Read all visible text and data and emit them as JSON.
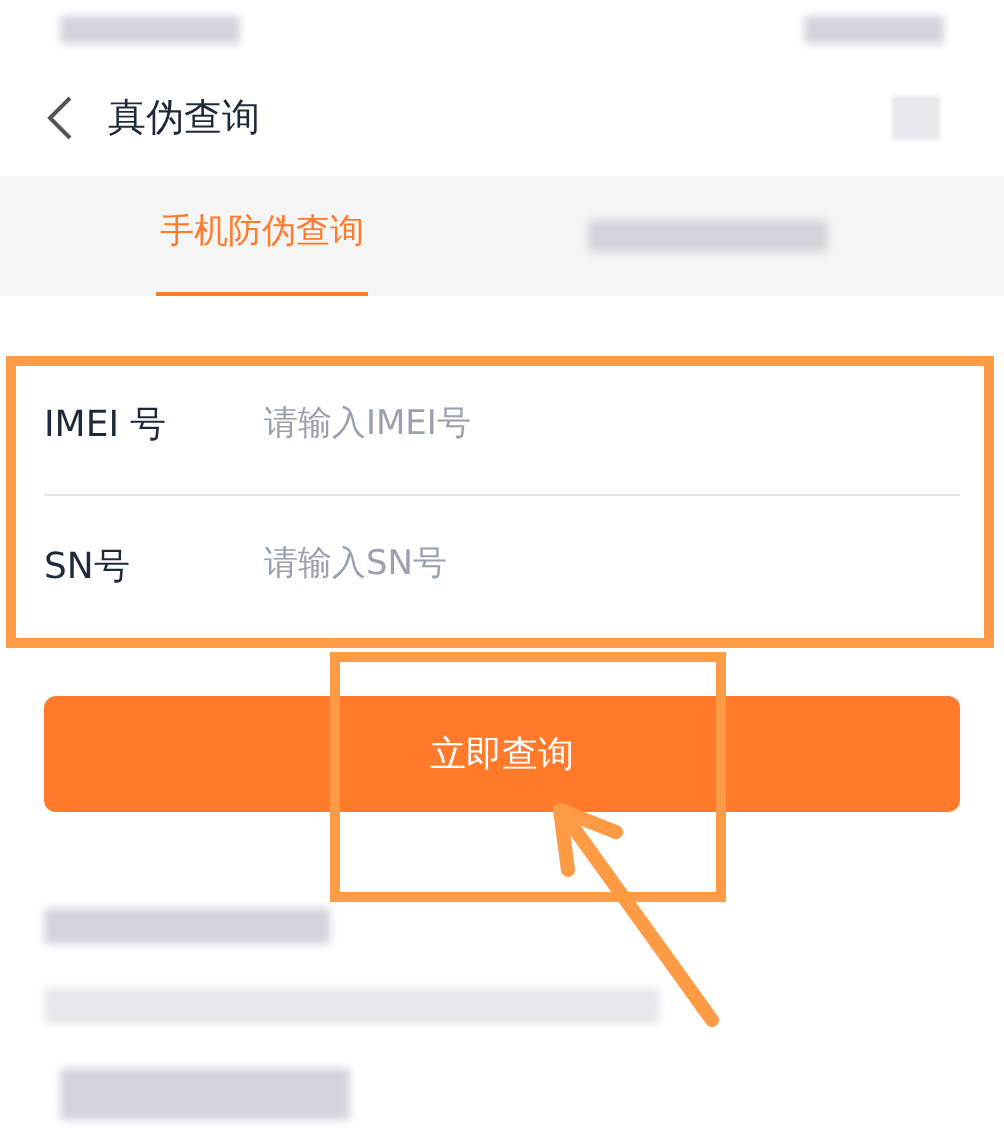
{
  "header": {
    "title": "真伪查询"
  },
  "tabs": [
    {
      "label": "手机防伪查询",
      "selected": true
    }
  ],
  "fields": [
    {
      "label": "IMEI 号",
      "placeholder": "请输入IMEI号"
    },
    {
      "label": "SN号",
      "placeholder": "请输入SN号"
    }
  ],
  "submit_button": {
    "label": "立即查询"
  }
}
